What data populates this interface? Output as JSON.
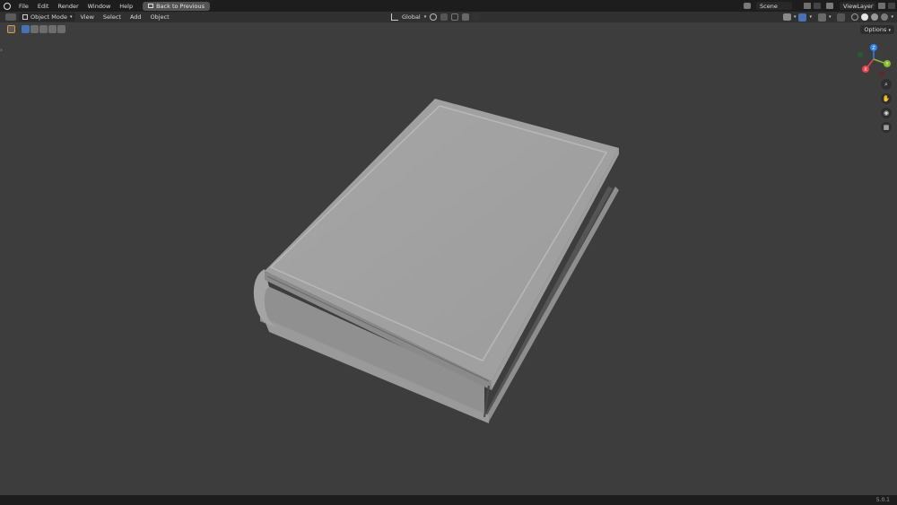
{
  "menu": [
    "File",
    "Edit",
    "Render",
    "Window",
    "Help"
  ],
  "back_button": "Back to Previous",
  "scene": "Scene",
  "view_layer": "ViewLayer",
  "header": {
    "mode": "Object Mode",
    "items": [
      "View",
      "Select",
      "Add",
      "Object"
    ],
    "orientation": "Global"
  },
  "options_label": "Options",
  "gizmo": {
    "x": "X",
    "y": "Y",
    "z": "Z"
  },
  "version": "5.0.1",
  "colors": {
    "x_axis": "#e8414f",
    "y_axis": "#86b92d",
    "z_axis": "#2f83e8",
    "accent": "#4772b3"
  }
}
